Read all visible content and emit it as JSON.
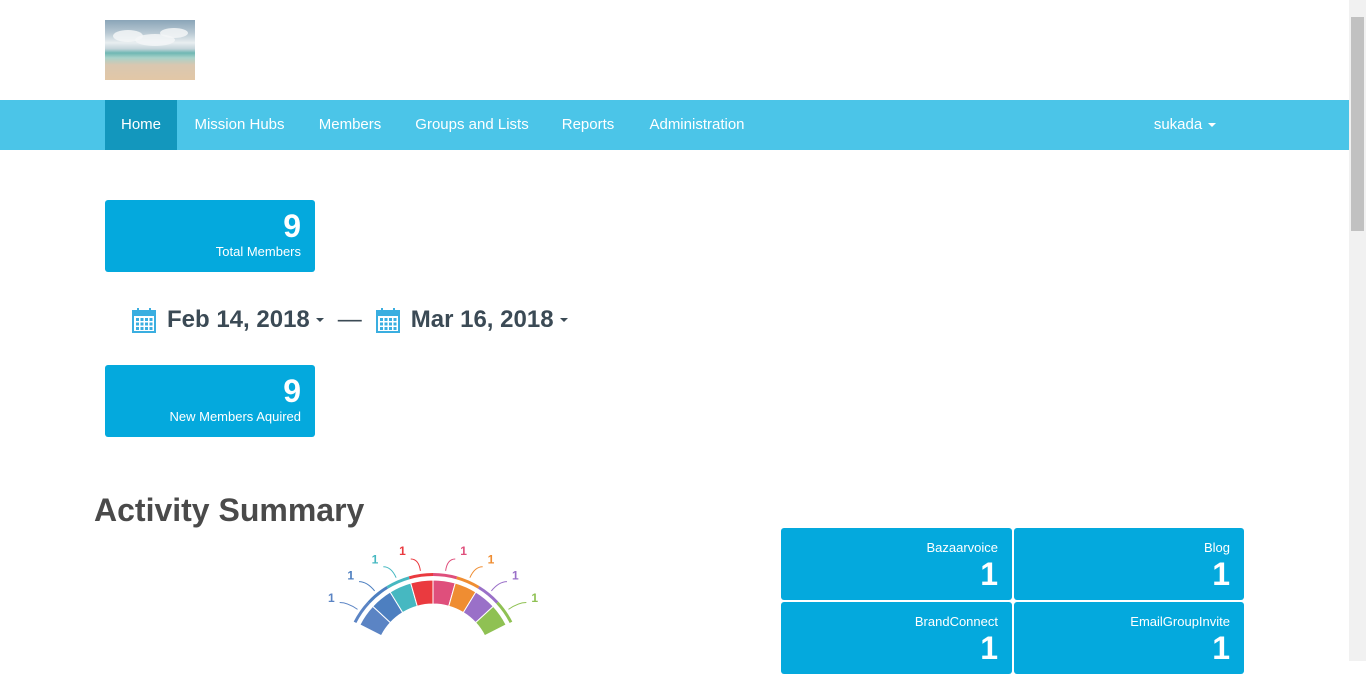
{
  "nav": {
    "items": [
      "Home",
      "Mission Hubs",
      "Members",
      "Groups and Lists",
      "Reports",
      "Administration"
    ],
    "active": "Home",
    "user": "sukada"
  },
  "stats": {
    "total_members": {
      "value": "9",
      "label": "Total Members"
    },
    "new_members": {
      "value": "9",
      "label": "New Members Aquired"
    }
  },
  "date_range": {
    "start": "Feb 14, 2018",
    "separator": "—",
    "end": "Mar 16, 2018"
  },
  "activity": {
    "title": "Activity Summary",
    "tiles": [
      {
        "name": "Bazaarvoice",
        "count": "1"
      },
      {
        "name": "Blog",
        "count": "1"
      },
      {
        "name": "BrandConnect",
        "count": "1"
      },
      {
        "name": "EmailGroupInvite",
        "count": "1"
      }
    ]
  },
  "chart_data": {
    "type": "pie",
    "values": [
      1,
      1,
      1,
      1,
      1,
      1,
      1,
      1
    ],
    "colors": [
      "#5b84c4",
      "#4d7fc0",
      "#46b8c1",
      "#ea3a3f",
      "#df4f7c",
      "#ef8d32",
      "#9a70c8",
      "#8fc153"
    ]
  },
  "colors": {
    "navbar": "#4bc5e8",
    "nav_active": "#1397bd",
    "tile": "#04a9dd"
  }
}
